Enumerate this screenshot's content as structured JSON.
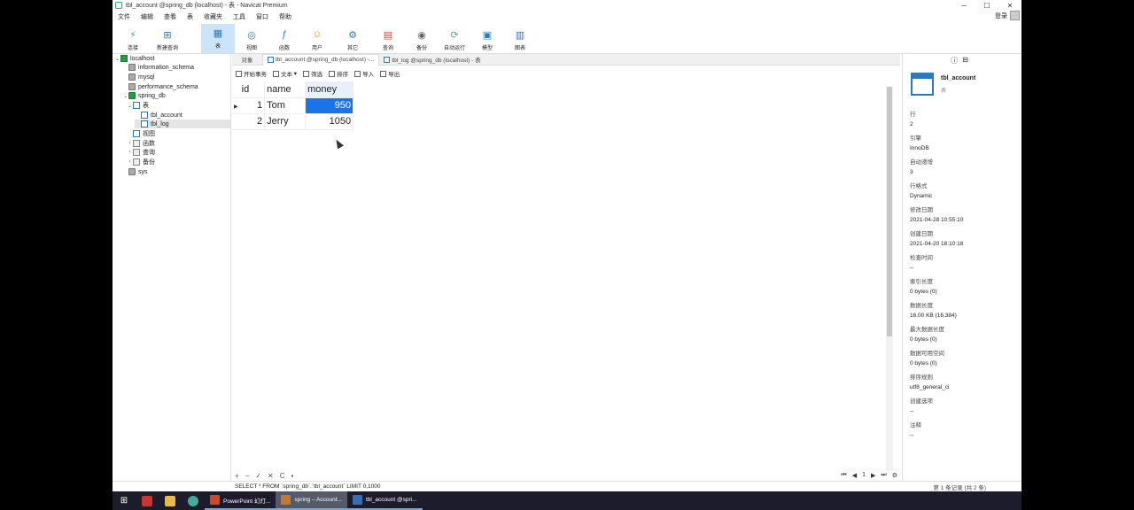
{
  "window": {
    "title": "tbl_account @spring_db (localhost) - 表 - Navicat Premium",
    "controls": [
      "─",
      "☐",
      "✕"
    ]
  },
  "menu": [
    "文件",
    "编辑",
    "查看",
    "表",
    "收藏夹",
    "工具",
    "窗口",
    "帮助"
  ],
  "login_label": "登录",
  "toolbar": [
    {
      "label": "连接",
      "icon": "connection-icon"
    },
    {
      "label": "新建查询",
      "icon": "new-query-icon"
    },
    {
      "label": "表",
      "icon": "table-icon",
      "active": true
    },
    {
      "label": "视图",
      "icon": "view-icon"
    },
    {
      "label": "函数",
      "icon": "function-icon"
    },
    {
      "label": "用户",
      "icon": "user-icon"
    },
    {
      "label": "其它",
      "icon": "other-icon"
    },
    {
      "label": "查询",
      "icon": "query-icon"
    },
    {
      "label": "备份",
      "icon": "backup-icon"
    },
    {
      "label": "自动运行",
      "icon": "automation-icon"
    },
    {
      "label": "模型",
      "icon": "model-icon"
    },
    {
      "label": "图表",
      "icon": "chart-icon"
    }
  ],
  "toolbar_glyphs": [
    "⚡",
    "⊞",
    "▦",
    "◎",
    "ƒ",
    "☺",
    "⚙",
    "▤",
    "◉",
    "⟳",
    "▣",
    "▥"
  ],
  "tree": {
    "localhost": "localhost",
    "information_schema": "information_schema",
    "mysql": "mysql",
    "performance_schema": "performance_schema",
    "spring_db": "spring_db",
    "tables": "表",
    "tbl_account": "tbl_account",
    "tbl_log": "tbl_log",
    "views": "视图",
    "functions": "函数",
    "queries": "查询",
    "backups": "备份",
    "sys": "sys"
  },
  "tabs": {
    "objects": "对象",
    "tab1": "tbl_account @spring_db (localhost) -...",
    "tab2": "tbl_log @spring_db (localhost) - 表"
  },
  "subtoolbar": {
    "begin_tx": "开始事务",
    "text": "文本",
    "filter": "筛选",
    "sort": "排序",
    "import": "导入",
    "export": "导出"
  },
  "grid": {
    "columns": [
      "id",
      "name",
      "money"
    ],
    "rows": [
      {
        "id": "1",
        "name": "Tom",
        "money": "950"
      },
      {
        "id": "2",
        "name": "Jerry",
        "money": "1050"
      }
    ]
  },
  "info_panel": {
    "name": "tbl_account",
    "type": "表",
    "props": [
      {
        "k": "行",
        "v": "2"
      },
      {
        "k": "引擎",
        "v": "InnoDB"
      },
      {
        "k": "自动递增",
        "v": "3"
      },
      {
        "k": "行格式",
        "v": "Dynamic"
      },
      {
        "k": "修改日期",
        "v": "2021-04-28 10:55:10"
      },
      {
        "k": "创建日期",
        "v": "2021-04-20 18:10:18"
      },
      {
        "k": "检查时间",
        "v": "--"
      },
      {
        "k": "索引长度",
        "v": "0 bytes (0)"
      },
      {
        "k": "数据长度",
        "v": "16.00 KB (16,384)"
      },
      {
        "k": "最大数据长度",
        "v": "0 bytes (0)"
      },
      {
        "k": "数据可用空间",
        "v": "0 bytes (0)"
      },
      {
        "k": "排序规则",
        "v": "utf8_general_ci"
      },
      {
        "k": "创建选项",
        "v": "--"
      },
      {
        "k": "注释",
        "v": "--"
      }
    ]
  },
  "bottom": {
    "page": "1",
    "left_glyphs": [
      "+",
      "−",
      "✓",
      "✕",
      "C",
      "▪"
    ],
    "right_glyphs": [
      "⏮",
      "◀",
      "▶",
      "⏭",
      "⚙"
    ]
  },
  "status": {
    "sql": "SELECT * FROM `spring_db`.`tbl_account` LIMIT 0,1000",
    "records": "第 1 条记录 (共 2 条)"
  },
  "taskbar": {
    "start": "⊞",
    "items": [
      {
        "label": "PowerPoint 幻灯...",
        "color": "#d24726"
      },
      {
        "label": "spring – Account...",
        "color": "#c67a2c",
        "active": true
      },
      {
        "label": "tbl_account @spri...",
        "color": "#3a6fb0"
      }
    ]
  }
}
